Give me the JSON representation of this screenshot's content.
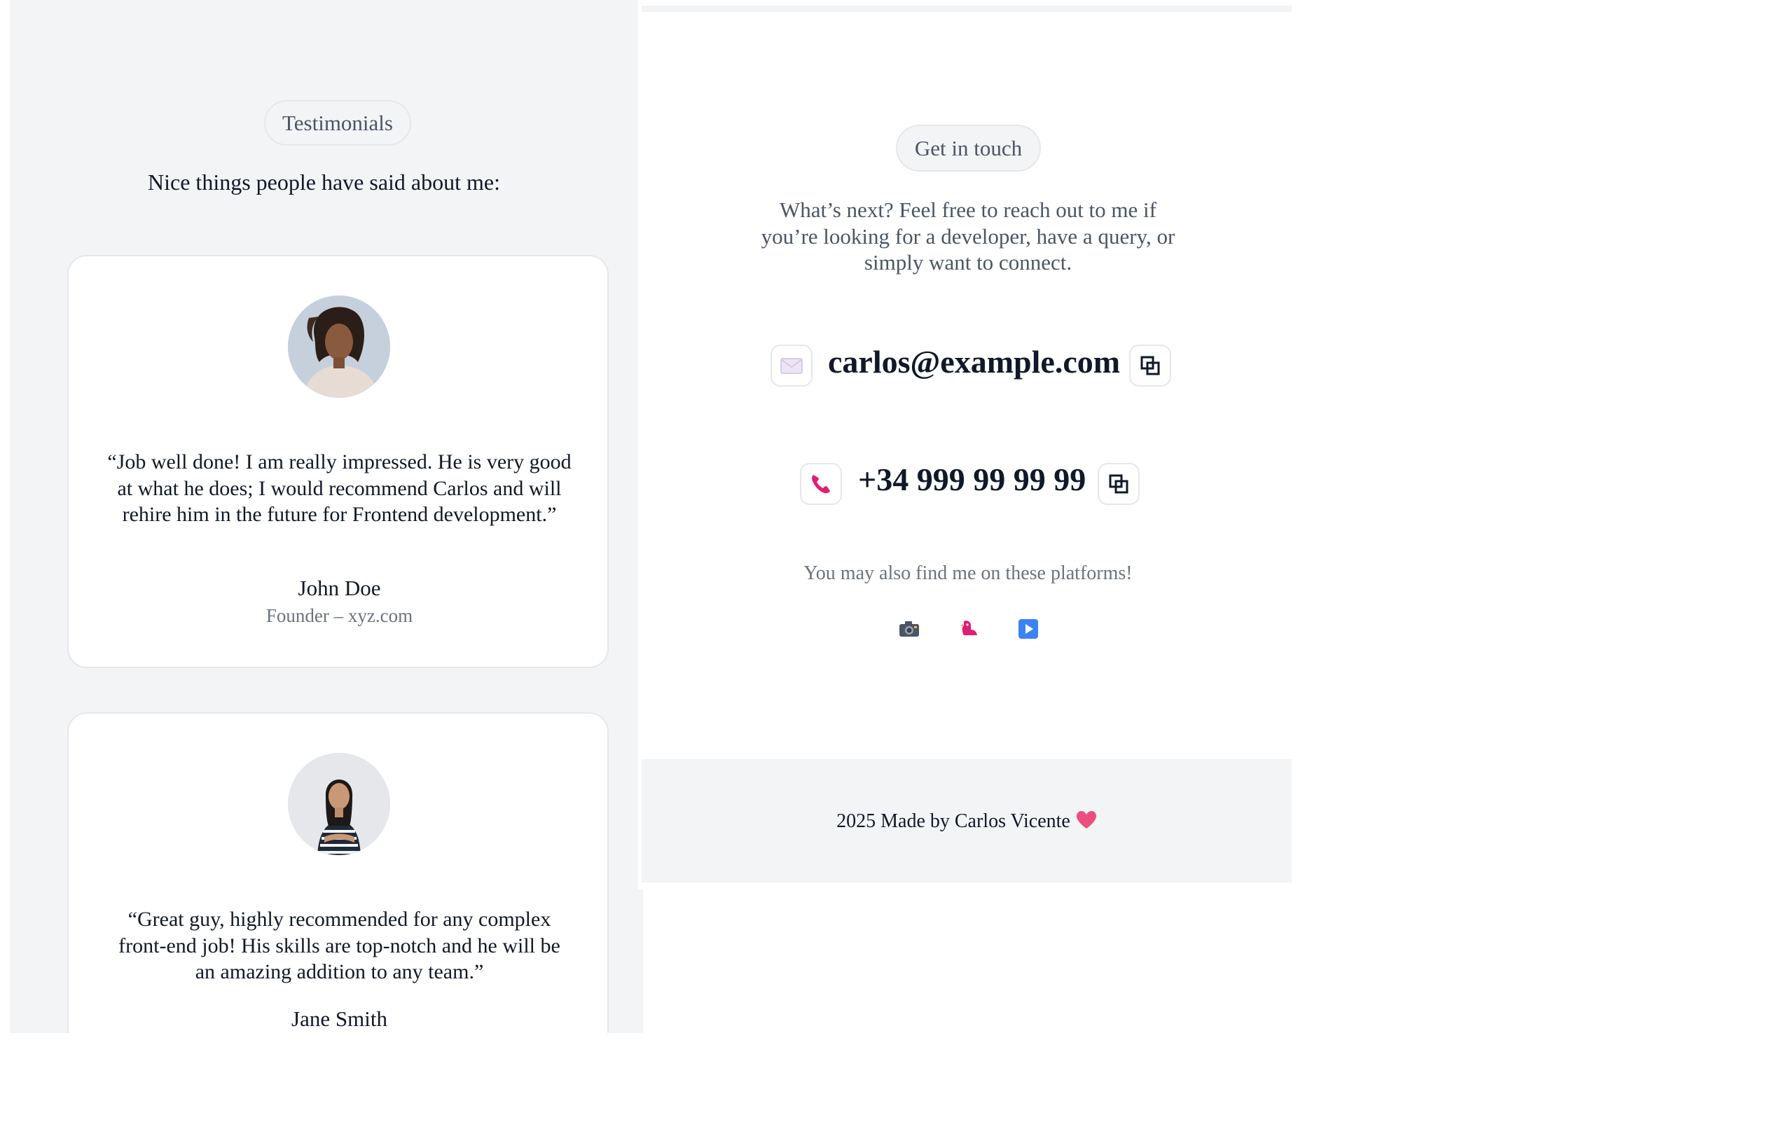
{
  "testimonials": {
    "badge": "Testimonials",
    "heading": "Nice things people have said about me:",
    "items": [
      {
        "quote": "“Job well done! I am really impressed. He is very good at what he does; I would recommend Carlos and will rehire him in the future for Frontend development.”",
        "name": "John Doe",
        "role": "Founder – xyz.com"
      },
      {
        "quote": "“Great guy, highly recommended for any complex front-end job! His skills are top-notch and he will be an amazing addition to any team.”",
        "name": "Jane Smith"
      }
    ]
  },
  "contact": {
    "badge": "Get in touch",
    "description": "What’s next? Feel free to reach out to me if you’re looking for a developer, have a query, or simply want to connect.",
    "email": "carlos@example.com",
    "phone": "+34 999 99 99 99",
    "platforms_text": "You may also find me on these platforms!",
    "platforms": [
      "camera-icon",
      "bird-icon",
      "play-icon"
    ]
  },
  "footer": {
    "text": "2025 Made by Carlos Vicente"
  }
}
